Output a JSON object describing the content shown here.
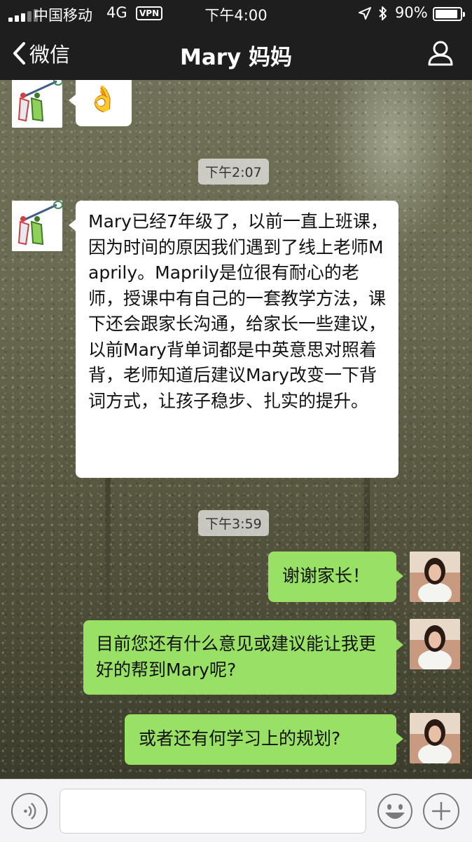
{
  "status_bar": {
    "carrier": "中国移动",
    "network": "4G",
    "vpn": "VPN",
    "time": "下午4:00",
    "battery": "90%",
    "battery_level": 0.9
  },
  "nav": {
    "back_label": "微信",
    "title": "Mary 妈妈"
  },
  "messages": {
    "m0": {
      "from": "other",
      "type": "emoji",
      "icon": "ok-hand-emoji",
      "text": "👌"
    },
    "t1": "下午2:07",
    "m1": {
      "from": "other",
      "text": "Mary已经7年级了，以前一直上班课，因为时间的原因我们遇到了线上老师Maprily。Maprily是位很有耐心的老师，授课中有自己的一套教学方法，课下还会跟家长沟通，给家长一些建议，以前Mary背单词都是中英意思对照着背，老师知道后建议Mary改变一下背词方式，让孩子稳步、扎实的提升。"
    },
    "t2": "下午3:59",
    "m2": {
      "from": "self",
      "text": "谢谢家长！"
    },
    "m3": {
      "from": "self",
      "text": "目前您还有什么意见或建议能让我更好的帮到Mary呢?"
    },
    "m4": {
      "from": "self",
      "text": "或者还有何学习上的规划?"
    }
  },
  "input_bar": {
    "icons": [
      "voice-icon",
      "emoji-icon",
      "plus-icon"
    ]
  },
  "colors": {
    "header_bg": "#1e1e1e",
    "bubble_self": "#98e165",
    "bubble_other": "#ffffff",
    "input_bar_bg": "#f4f4f6"
  }
}
